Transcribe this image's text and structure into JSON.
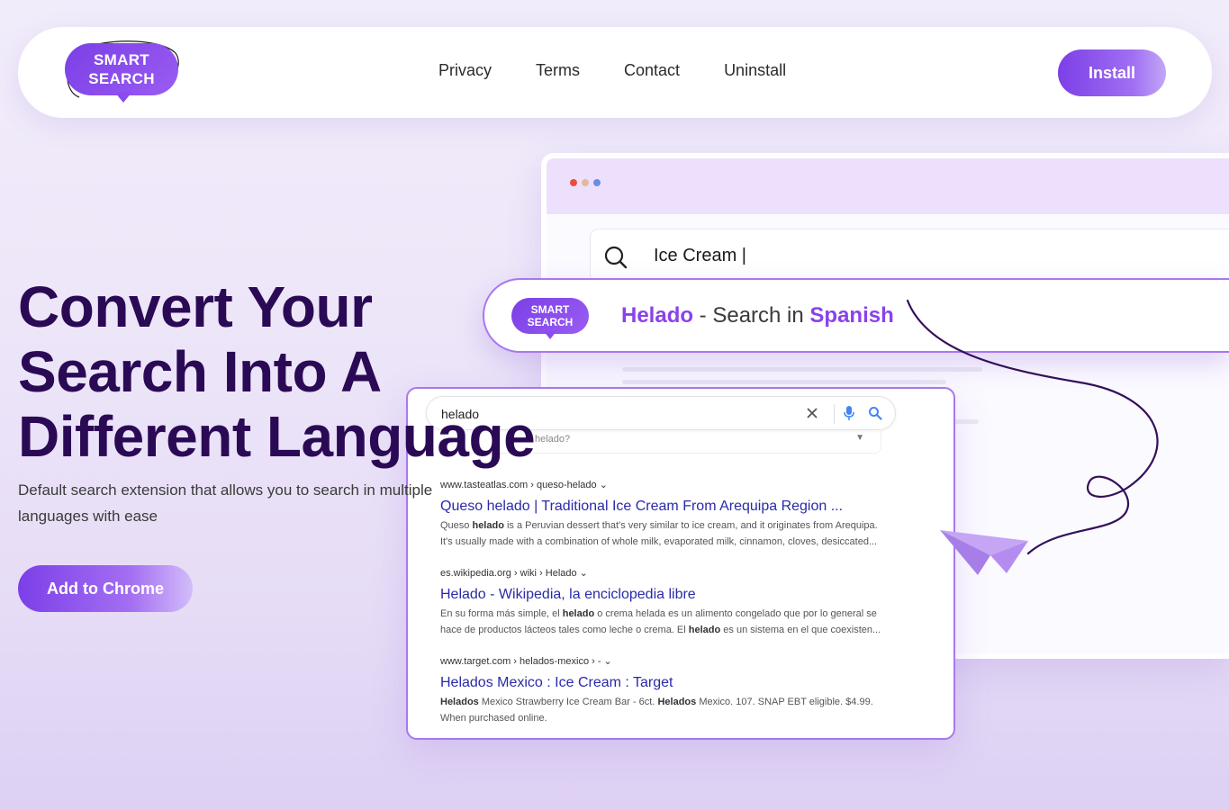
{
  "logo": {
    "line1": "SMART",
    "line2": "SEARCH"
  },
  "nav": {
    "links": [
      "Privacy",
      "Terms",
      "Contact",
      "Uninstall"
    ],
    "install_label": "Install"
  },
  "hero": {
    "title_lines": [
      "Convert Your",
      "Search Into A",
      "Different Language"
    ],
    "subtitle": "Default search extension that allows you to search in multiple languages with ease",
    "cta_label": "Add to Chrome"
  },
  "browser": {
    "query": "Ice Cream |"
  },
  "suggestion": {
    "logo_line1": "SMART",
    "logo_line2": "SEARCH",
    "word": "Helado",
    "sep": " - ",
    "middle": "Search in ",
    "language": "Spanish"
  },
  "results": {
    "query": "helado",
    "dropdown_text": "helado?",
    "items": [
      {
        "url": "www.tasteatlas.com › queso-helado ⌄",
        "title": "Queso helado | Traditional Ice Cream From Arequipa Region ...",
        "snippet_1": "Queso helado is a Peruvian dessert that's very similar to ice cream, and it originates from Arequipa.",
        "snippet_2": "It's usually made with a combination of whole milk, evaporated milk, cinnamon, cloves, desiccated..."
      },
      {
        "url": "es.wikipedia.org › wiki › Helado ⌄",
        "title": "Helado - Wikipedia, la enciclopedia libre",
        "snippet_1": "En su forma más simple, el helado o crema helada es un alimento congelado que por lo general se",
        "snippet_2": "hace de productos lácteos tales como leche o crema. El helado es un sistema en el que coexisten..."
      },
      {
        "url": "www.target.com › helados-mexico › - ⌄",
        "title": "Helados Mexico : Ice Cream : Target",
        "snippet_1": "Helados Mexico Strawberry Ice Cream Bar - 6ct. Helados Mexico. 107. SNAP EBT eligible. $4.99.",
        "snippet_2": "When purchased online."
      }
    ]
  },
  "colors": {
    "brand": "#8a42ea",
    "heading": "#2b0a55",
    "link": "#2a2aa8"
  }
}
